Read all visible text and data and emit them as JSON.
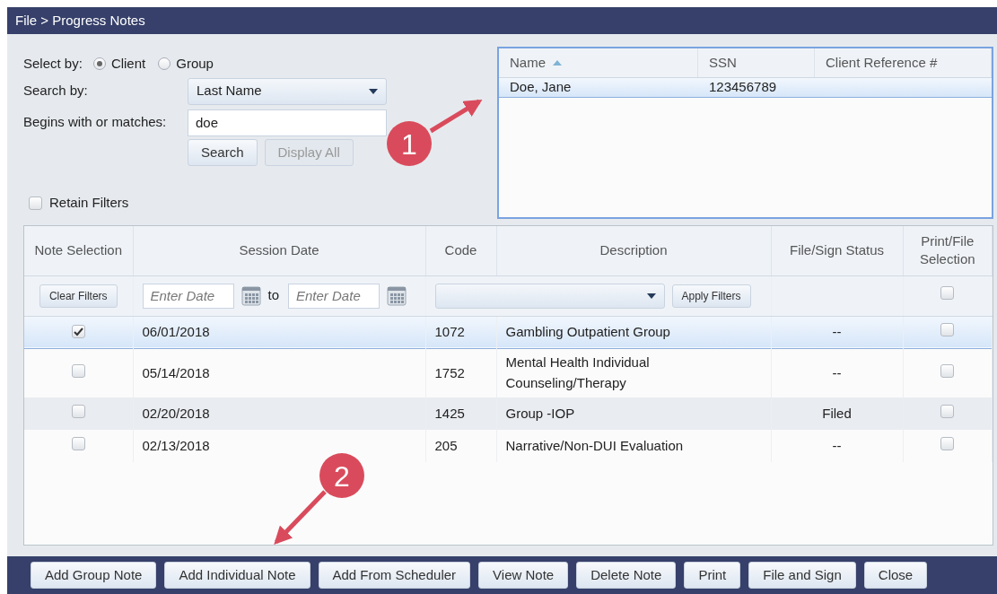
{
  "window": {
    "title": "File > Progress Notes"
  },
  "select_by": {
    "label": "Select by:",
    "options": [
      {
        "label": "Client",
        "selected": true
      },
      {
        "label": "Group",
        "selected": false
      }
    ]
  },
  "search_by": {
    "label": "Search by:",
    "value": "Last Name"
  },
  "begins_with": {
    "label": "Begins with or matches:",
    "value": "doe"
  },
  "search_buttons": [
    {
      "label": "Search",
      "disabled": false
    },
    {
      "label": "Display All",
      "disabled": true
    }
  ],
  "retain_filters": {
    "label": "Retain Filters",
    "checked": false
  },
  "client_grid": {
    "columns": [
      {
        "label": "Name",
        "sorted": true
      },
      {
        "label": "SSN",
        "sorted": false
      },
      {
        "label": "Client Reference #",
        "sorted": false
      }
    ],
    "rows": [
      {
        "cells": [
          "Doe, Jane",
          "123456789"
        ],
        "selected": true
      }
    ]
  },
  "notes_grid": {
    "columns": [
      "Note Selection",
      "Session Date",
      "Code",
      "Description",
      "File/Sign Status",
      "Print/File Selection"
    ],
    "filters": {
      "clear_button": "Clear Filters",
      "date_from_placeholder": "Enter Date",
      "to_label": "to",
      "date_to_placeholder": "Enter Date",
      "apply_button": "Apply Filters",
      "print_all_checked": false
    },
    "rows": [
      {
        "checked": true,
        "selected": true,
        "date": "06/01/2018",
        "code": "1072",
        "description": "Gambling Outpatient Group",
        "status": "--",
        "print_checked": false
      },
      {
        "checked": false,
        "selected": false,
        "date": "05/14/2018",
        "code": "1752",
        "description": "Mental Health Individual Counseling/Therapy",
        "status": "--",
        "print_checked": false
      },
      {
        "checked": false,
        "selected": false,
        "date": "02/20/2018",
        "code": "1425",
        "description": "Group -IOP",
        "status": "Filed",
        "print_checked": false
      },
      {
        "checked": false,
        "selected": false,
        "date": "02/13/2018",
        "code": "205",
        "description": "Narrative/Non-DUI Evaluation",
        "status": "--",
        "print_checked": false
      }
    ]
  },
  "footer_buttons": [
    "Add Group Note",
    "Add Individual Note",
    "Add From Scheduler",
    "View Note",
    "Delete Note",
    "Print",
    "File and Sign",
    "Close"
  ],
  "callouts": [
    {
      "label": "1"
    },
    {
      "label": "2"
    }
  ]
}
